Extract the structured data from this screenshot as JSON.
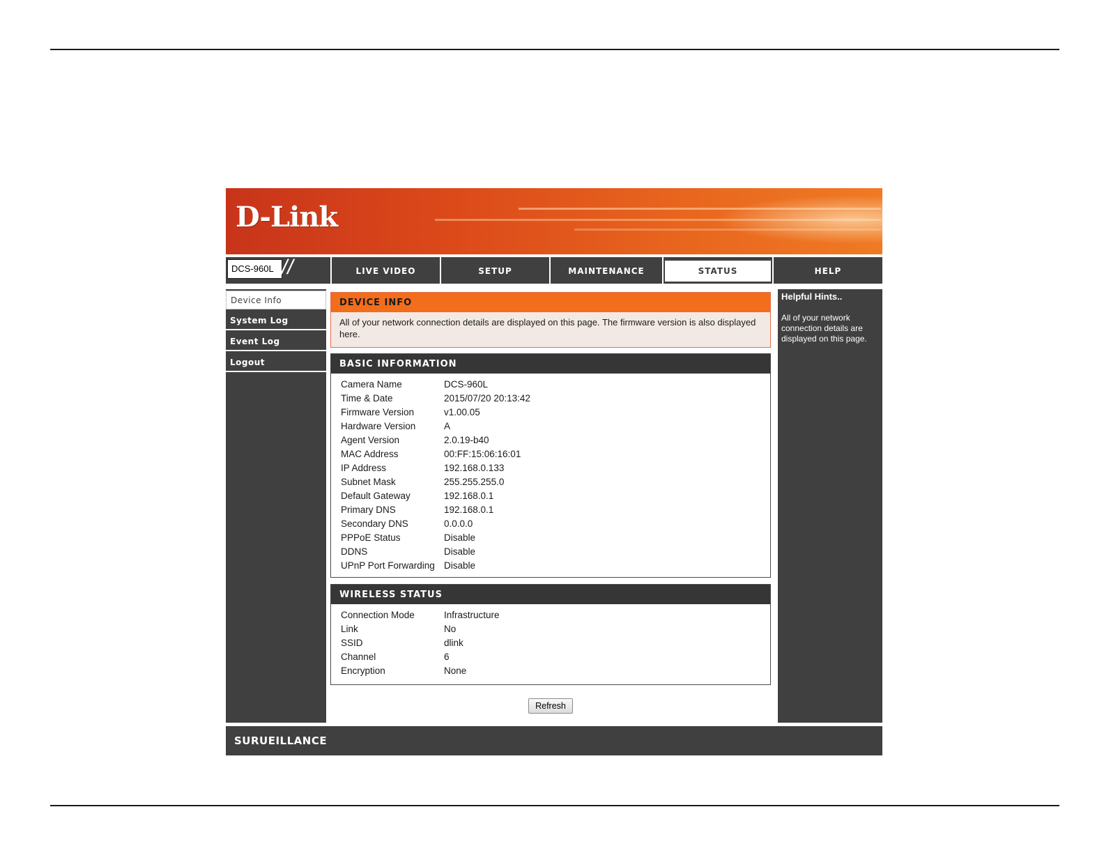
{
  "brand": {
    "logo_text": "D-Link",
    "model": "DCS-960L",
    "footer_brand": "SURUEILLANCE"
  },
  "nav": {
    "tabs": [
      {
        "label": "LIVE VIDEO"
      },
      {
        "label": "SETUP"
      },
      {
        "label": "MAINTENANCE"
      },
      {
        "label": "STATUS",
        "active": true
      },
      {
        "label": "HELP"
      }
    ]
  },
  "sidebar": {
    "items": [
      {
        "label": "Device Info",
        "active": true
      },
      {
        "label": "System Log"
      },
      {
        "label": "Event Log"
      },
      {
        "label": "Logout"
      }
    ]
  },
  "device_info": {
    "title": "DEVICE INFO",
    "description": "All of your network connection details are displayed on this page. The firmware version is also displayed here."
  },
  "basic_information": {
    "title": "BASIC INFORMATION",
    "rows": [
      {
        "label": "Camera Name",
        "value": "DCS-960L"
      },
      {
        "label": "Time & Date",
        "value": "2015/07/20 20:13:42"
      },
      {
        "label": "Firmware Version",
        "value": "v1.00.05"
      },
      {
        "label": "Hardware Version",
        "value": "A"
      },
      {
        "label": "Agent Version",
        "value": "2.0.19-b40"
      },
      {
        "label": "MAC Address",
        "value": "00:FF:15:06:16:01"
      },
      {
        "label": "IP Address",
        "value": "192.168.0.133"
      },
      {
        "label": "Subnet Mask",
        "value": "255.255.255.0"
      },
      {
        "label": "Default Gateway",
        "value": "192.168.0.1"
      },
      {
        "label": "Primary DNS",
        "value": "192.168.0.1"
      },
      {
        "label": "Secondary DNS",
        "value": "0.0.0.0"
      },
      {
        "label": "PPPoE Status",
        "value": "Disable"
      },
      {
        "label": "DDNS",
        "value": "Disable"
      },
      {
        "label": "UPnP Port Forwarding",
        "value": "Disable"
      }
    ]
  },
  "wireless_status": {
    "title": "WIRELESS STATUS",
    "rows": [
      {
        "label": "Connection Mode",
        "value": "Infrastructure"
      },
      {
        "label": "Link",
        "value": "No"
      },
      {
        "label": "SSID",
        "value": "dlink"
      },
      {
        "label": "Channel",
        "value": "6"
      },
      {
        "label": "Encryption",
        "value": "None"
      }
    ]
  },
  "actions": {
    "refresh_label": "Refresh"
  },
  "help": {
    "title": "Helpful Hints..",
    "text": "All of your network connection details are displayed on this page."
  },
  "colors": {
    "accent_orange": "#f26d1c",
    "panel_dark": "#404040",
    "section_header": "#363636"
  }
}
